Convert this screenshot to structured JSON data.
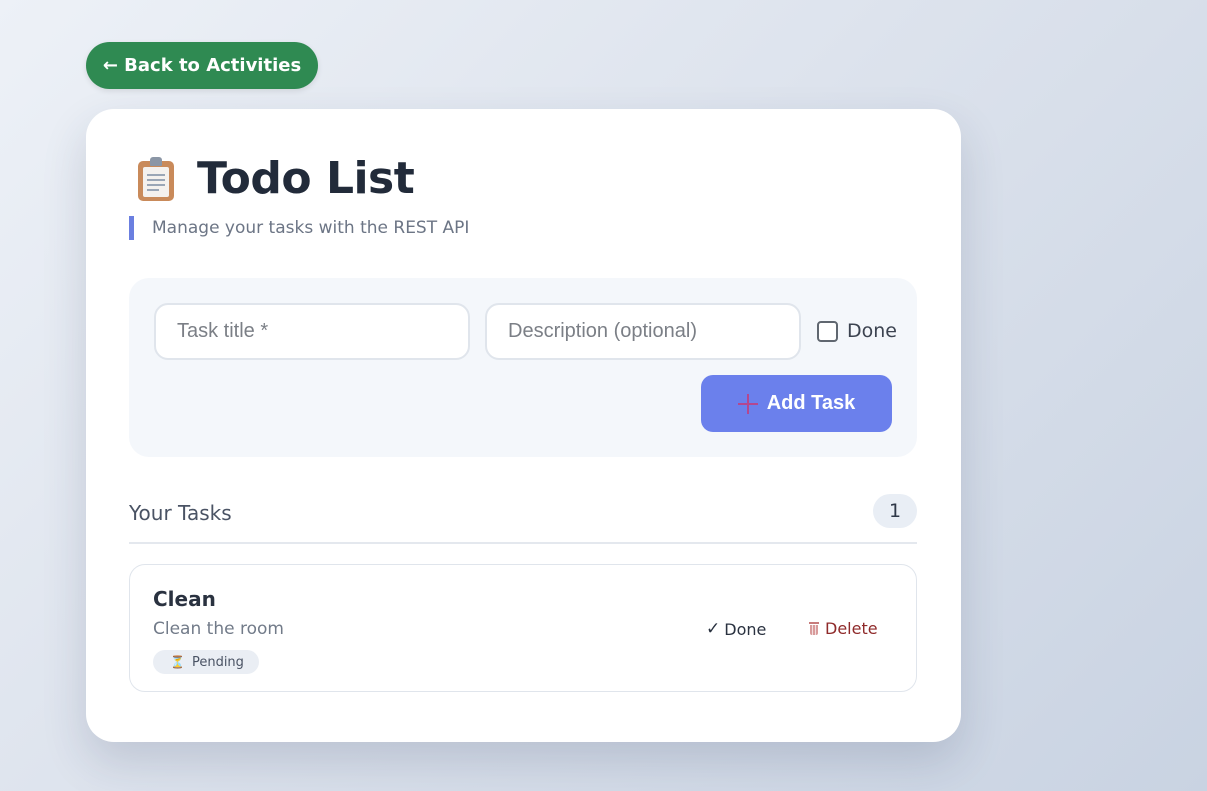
{
  "nav": {
    "back_label": "← Back to Activities"
  },
  "header": {
    "icon": "clipboard-icon",
    "title": "Todo List",
    "subtitle": "Manage your tasks with the REST API"
  },
  "form": {
    "title_placeholder": "Task title *",
    "description_placeholder": "Description (optional)",
    "done_label": "Done",
    "done_checked": false,
    "add_label": "Add Task",
    "add_icon": "plus-icon"
  },
  "tasks": {
    "heading": "Your Tasks",
    "count": "1",
    "items": [
      {
        "title": "Clean",
        "description": "Clean the room",
        "status": "Pending",
        "status_icon": "hourglass-icon",
        "done_action": "Done",
        "delete_action": "Delete"
      }
    ]
  },
  "colors": {
    "back_button": "#2f8a52",
    "add_button": "#6b80ec",
    "accent_bar": "#6b7fe0",
    "delete_text": "#8f2a2a"
  }
}
